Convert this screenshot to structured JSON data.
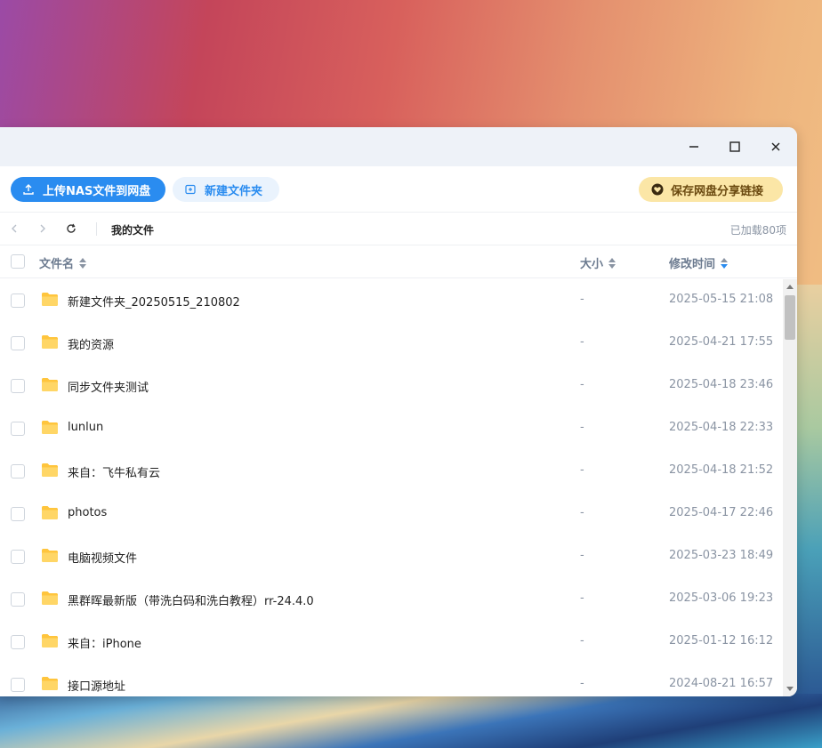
{
  "toolbar": {
    "upload_label": "上传NAS文件到网盘",
    "new_folder_label": "新建文件夹",
    "save_share_label": "保存网盘分享链接"
  },
  "navbar": {
    "breadcrumb": "我的文件",
    "loaded_count": "已加载80项"
  },
  "columns": {
    "name": "文件名",
    "size": "大小",
    "modified": "修改时间"
  },
  "files": [
    {
      "name": "新建文件夹_20250515_210802",
      "size": "-",
      "modified": "2025-05-15 21:08"
    },
    {
      "name": "我的资源",
      "size": "-",
      "modified": "2025-04-21 17:55"
    },
    {
      "name": "同步文件夹测试",
      "size": "-",
      "modified": "2025-04-18 23:46"
    },
    {
      "name": "lunlun",
      "size": "-",
      "modified": "2025-04-18 22:33"
    },
    {
      "name": "来自：飞牛私有云",
      "size": "-",
      "modified": "2025-04-18 21:52"
    },
    {
      "name": "photos",
      "size": "-",
      "modified": "2025-04-17 22:46"
    },
    {
      "name": "电脑视频文件",
      "size": "-",
      "modified": "2025-03-23 18:49"
    },
    {
      "name": "黑群晖最新版（带洗白码和洗白教程）rr-24.4.0",
      "size": "-",
      "modified": "2025-03-06 19:23"
    },
    {
      "name": "来自：iPhone",
      "size": "-",
      "modified": "2025-01-12 16:12"
    },
    {
      "name": "接口源地址",
      "size": "-",
      "modified": "2024-08-21 16:57"
    }
  ],
  "colors": {
    "accent": "#2a8cf0",
    "folder": "#ffc53d",
    "save_button_bg": "#fbe6a6"
  }
}
